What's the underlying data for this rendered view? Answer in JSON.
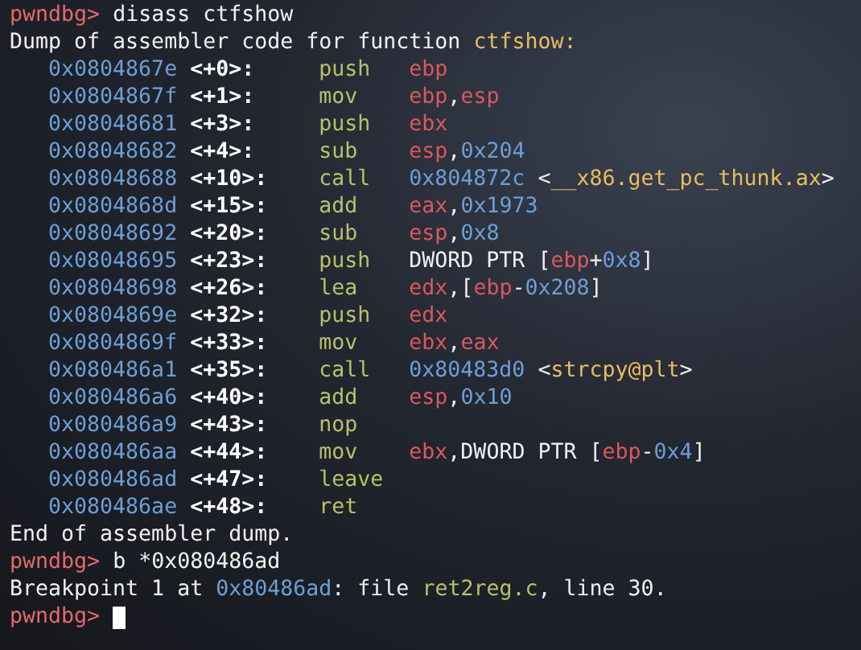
{
  "lines": [
    {
      "kind": "prompt",
      "prompt": "pwndbg>",
      "command": "disass ctfshow"
    },
    {
      "kind": "text",
      "segments": [
        {
          "kind": "plain",
          "text": "Dump of assembler code for function "
        },
        {
          "kind": "sym",
          "text": "ctfshow:"
        }
      ]
    },
    {
      "kind": "instruction",
      "address": "0x0804867e",
      "offset": "<+0>:",
      "mnemonic": "push",
      "operands": [
        {
          "kind": "reg",
          "text": "ebp"
        }
      ]
    },
    {
      "kind": "instruction",
      "address": "0x0804867f",
      "offset": "<+1>:",
      "mnemonic": "mov",
      "operands": [
        {
          "kind": "reg",
          "text": "ebp"
        },
        {
          "kind": "plain",
          "text": ","
        },
        {
          "kind": "reg",
          "text": "esp"
        }
      ]
    },
    {
      "kind": "instruction",
      "address": "0x08048681",
      "offset": "<+3>:",
      "mnemonic": "push",
      "operands": [
        {
          "kind": "reg",
          "text": "ebx"
        }
      ]
    },
    {
      "kind": "instruction",
      "address": "0x08048682",
      "offset": "<+4>:",
      "mnemonic": "sub",
      "operands": [
        {
          "kind": "reg",
          "text": "esp"
        },
        {
          "kind": "plain",
          "text": ","
        },
        {
          "kind": "num",
          "text": "0x204"
        }
      ]
    },
    {
      "kind": "instruction",
      "address": "0x08048688",
      "offset": "<+10>:",
      "mnemonic": "call",
      "operands": [
        {
          "kind": "num",
          "text": "0x804872c"
        },
        {
          "kind": "plain",
          "text": " <"
        },
        {
          "kind": "sym",
          "text": "__x86.get_pc_thunk.ax"
        },
        {
          "kind": "plain",
          "text": ">"
        }
      ]
    },
    {
      "kind": "instruction",
      "address": "0x0804868d",
      "offset": "<+15>:",
      "mnemonic": "add",
      "operands": [
        {
          "kind": "reg",
          "text": "eax"
        },
        {
          "kind": "plain",
          "text": ","
        },
        {
          "kind": "num",
          "text": "0x1973"
        }
      ]
    },
    {
      "kind": "instruction",
      "address": "0x08048692",
      "offset": "<+20>:",
      "mnemonic": "sub",
      "operands": [
        {
          "kind": "reg",
          "text": "esp"
        },
        {
          "kind": "plain",
          "text": ","
        },
        {
          "kind": "num",
          "text": "0x8"
        }
      ]
    },
    {
      "kind": "instruction",
      "address": "0x08048695",
      "offset": "<+23>:",
      "mnemonic": "push",
      "operands": [
        {
          "kind": "plain",
          "text": "DWORD PTR ["
        },
        {
          "kind": "reg",
          "text": "ebp"
        },
        {
          "kind": "plain",
          "text": "+"
        },
        {
          "kind": "num",
          "text": "0x8"
        },
        {
          "kind": "plain",
          "text": "]"
        }
      ]
    },
    {
      "kind": "instruction",
      "address": "0x08048698",
      "offset": "<+26>:",
      "mnemonic": "lea",
      "operands": [
        {
          "kind": "reg",
          "text": "edx"
        },
        {
          "kind": "plain",
          "text": ",["
        },
        {
          "kind": "reg",
          "text": "ebp"
        },
        {
          "kind": "plain",
          "text": "-"
        },
        {
          "kind": "num",
          "text": "0x208"
        },
        {
          "kind": "plain",
          "text": "]"
        }
      ]
    },
    {
      "kind": "instruction",
      "address": "0x0804869e",
      "offset": "<+32>:",
      "mnemonic": "push",
      "operands": [
        {
          "kind": "reg",
          "text": "edx"
        }
      ]
    },
    {
      "kind": "instruction",
      "address": "0x0804869f",
      "offset": "<+33>:",
      "mnemonic": "mov",
      "operands": [
        {
          "kind": "reg",
          "text": "ebx"
        },
        {
          "kind": "plain",
          "text": ","
        },
        {
          "kind": "reg",
          "text": "eax"
        }
      ]
    },
    {
      "kind": "instruction",
      "address": "0x080486a1",
      "offset": "<+35>:",
      "mnemonic": "call",
      "operands": [
        {
          "kind": "num",
          "text": "0x80483d0"
        },
        {
          "kind": "plain",
          "text": " <"
        },
        {
          "kind": "sym",
          "text": "strcpy@plt"
        },
        {
          "kind": "plain",
          "text": ">"
        }
      ]
    },
    {
      "kind": "instruction",
      "address": "0x080486a6",
      "offset": "<+40>:",
      "mnemonic": "add",
      "operands": [
        {
          "kind": "reg",
          "text": "esp"
        },
        {
          "kind": "plain",
          "text": ","
        },
        {
          "kind": "num",
          "text": "0x10"
        }
      ]
    },
    {
      "kind": "instruction",
      "address": "0x080486a9",
      "offset": "<+43>:",
      "mnemonic": "nop"
    },
    {
      "kind": "instruction",
      "address": "0x080486aa",
      "offset": "<+44>:",
      "mnemonic": "mov",
      "operands": [
        {
          "kind": "reg",
          "text": "ebx"
        },
        {
          "kind": "plain",
          "text": ",DWORD PTR ["
        },
        {
          "kind": "reg",
          "text": "ebp"
        },
        {
          "kind": "plain",
          "text": "-"
        },
        {
          "kind": "num",
          "text": "0x4"
        },
        {
          "kind": "plain",
          "text": "]"
        }
      ]
    },
    {
      "kind": "instruction",
      "address": "0x080486ad",
      "offset": "<+47>:",
      "mnemonic": "leave"
    },
    {
      "kind": "instruction",
      "address": "0x080486ae",
      "offset": "<+48>:",
      "mnemonic": "ret"
    },
    {
      "kind": "text",
      "segments": [
        {
          "kind": "plain",
          "text": "End of assembler dump."
        }
      ]
    },
    {
      "kind": "prompt",
      "prompt": "pwndbg>",
      "command": "b *0x080486ad"
    },
    {
      "kind": "text",
      "segments": [
        {
          "kind": "plain",
          "text": "Breakpoint 1 at "
        },
        {
          "kind": "num",
          "text": "0x80486ad"
        },
        {
          "kind": "plain",
          "text": ": file "
        },
        {
          "kind": "file",
          "text": "ret2reg.c"
        },
        {
          "kind": "plain",
          "text": ", line 30."
        }
      ]
    },
    {
      "kind": "prompt",
      "prompt": "pwndbg>",
      "cursor": true
    }
  ]
}
